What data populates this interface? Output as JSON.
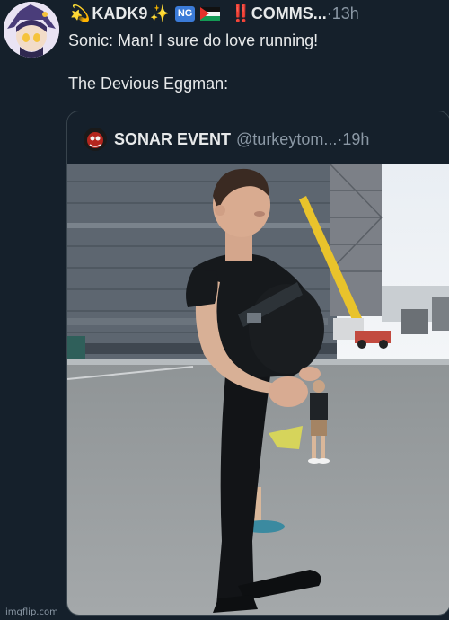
{
  "author": {
    "prefix_emoji": "💫",
    "name": "KADK9",
    "sparkle_emoji": "✨",
    "ng_badge": "NG",
    "bangs": "‼️",
    "comms": "COMMS...",
    "separator": "·",
    "time": "13h"
  },
  "tweet": {
    "line1": "Sonic: Man! I sure do love running!",
    "line2": "The Devious Eggman:"
  },
  "quoted": {
    "name": "SONAR EVENT",
    "handle": "@turkeytom...",
    "separator": "·",
    "time": "19h"
  },
  "watermark": "imgflip.com",
  "colors": {
    "background": "#15202b",
    "text": "#e7e9ea",
    "muted": "#8b98a5",
    "border": "#38444d"
  },
  "icons": [
    "dizzy-emoji-icon",
    "sparkles-emoji-icon",
    "ng-badge-icon",
    "palestine-flag-icon",
    "double-exclamation-icon"
  ]
}
